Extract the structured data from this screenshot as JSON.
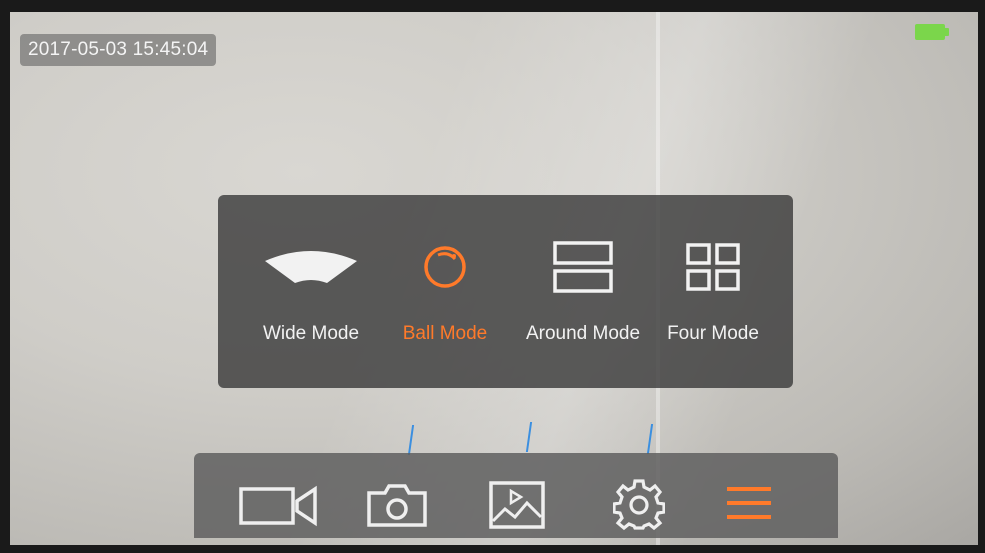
{
  "status": {
    "timestamp": "2017-05-03 15:45:04",
    "battery_color": "#7bd64b"
  },
  "mode_menu": {
    "items": [
      {
        "label": "Wide Mode",
        "icon": "wide-mode-icon",
        "active": false
      },
      {
        "label": "Ball Mode",
        "icon": "ball-mode-icon",
        "active": true
      },
      {
        "label": "Around Mode",
        "icon": "around-mode-icon",
        "active": false
      },
      {
        "label": "Four Mode",
        "icon": "four-mode-icon",
        "active": false
      }
    ],
    "active_color": "#ff7a2a",
    "text_color": "#f2f2f2"
  },
  "toolbar": {
    "items": [
      {
        "icon": "video-camera-icon"
      },
      {
        "icon": "camera-icon"
      },
      {
        "icon": "gallery-icon"
      },
      {
        "icon": "gear-icon"
      },
      {
        "icon": "menu-icon",
        "active": true
      }
    ]
  }
}
